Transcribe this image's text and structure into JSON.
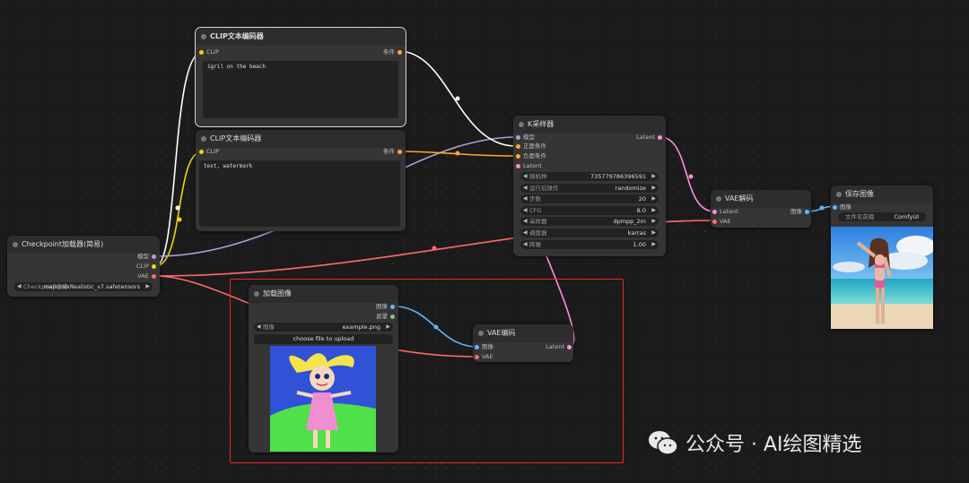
{
  "colors": {
    "clip": "#f5d20a",
    "model": "#b39ddb",
    "vae": "#ff6b6b",
    "cond": "#ffa930",
    "latent": "#ff8fd8",
    "image": "#64b5f6",
    "mask": "#81c784",
    "selection": "#e8291f"
  },
  "nodes": {
    "clip1": {
      "title": "CLIP文本编码器",
      "in_clip": "CLIP",
      "out": "条件",
      "text": "1gril on the beach"
    },
    "clip2": {
      "title": "CLIP文本编码器",
      "in_clip": "CLIP",
      "out": "条件",
      "text": "text, watermark"
    },
    "checkpoint": {
      "title": "Checkpoint加载器(简易)",
      "out_model": "模型",
      "out_clip": "CLIP",
      "out_vae": "VAE",
      "widget_label": "Checkpoint名称",
      "widget_value": "majicmixRealistic_v7.safetensors"
    },
    "ksampler": {
      "title": "K采样器",
      "inputs": [
        "模型",
        "正面条件",
        "负面条件",
        "Latent"
      ],
      "output": "Latent",
      "widgets": [
        {
          "label": "随机种",
          "value": "735779786396591"
        },
        {
          "label": "运行后操作",
          "value": "randomize"
        },
        {
          "label": "步数",
          "value": "20"
        },
        {
          "label": "CFG",
          "value": "8.0"
        },
        {
          "label": "采样器",
          "value": "dpmpp_2m"
        },
        {
          "label": "调度器",
          "value": "karras"
        },
        {
          "label": "降噪",
          "value": "1.00"
        }
      ]
    },
    "vaedecode": {
      "title": "VAE解码",
      "in_latent": "Latent",
      "in_vae": "VAE",
      "out": "图像"
    },
    "save": {
      "title": "保存图像",
      "in_image": "图像",
      "widget_label": "文件名前缀",
      "widget_value": "ComfyUI"
    },
    "loadimage": {
      "title": "加载图像",
      "out_image": "图像",
      "out_mask": "遮罩",
      "widget_label": "图像",
      "widget_value": "example.png",
      "upload": "choose file to upload"
    },
    "vaeencode": {
      "title": "VAE编码",
      "in_image": "图像",
      "in_vae": "VAE",
      "out": "Latent"
    }
  },
  "watermark": {
    "text": "公众号 · AI绘图精选",
    "icon": "wechat-icon"
  }
}
